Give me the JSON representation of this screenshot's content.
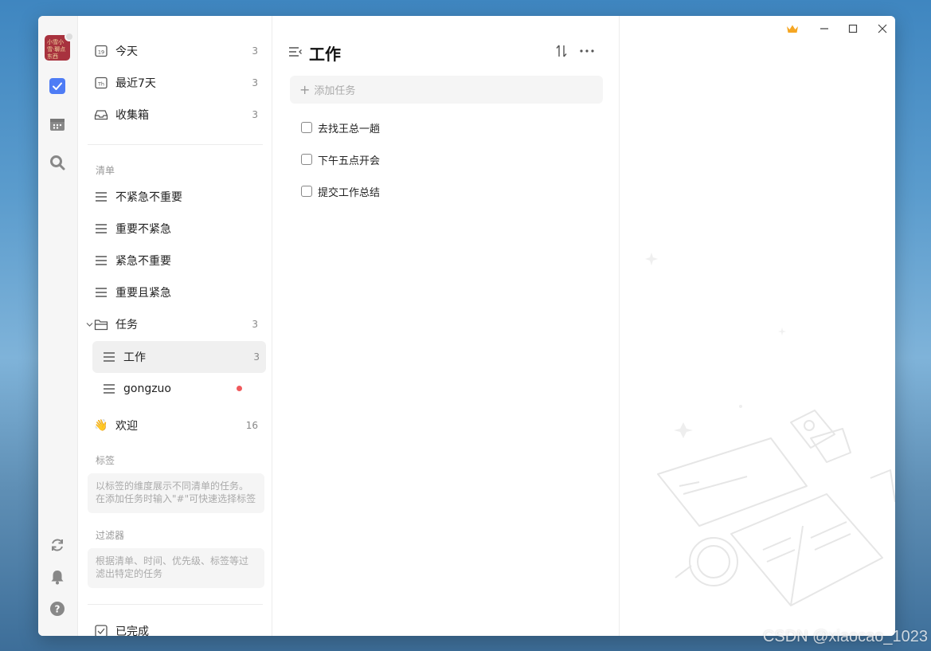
{
  "rail": {
    "avatar_text": "小雪小雪·聊点东西",
    "accent": "#4e7cf5"
  },
  "sidebar": {
    "smart": [
      {
        "label": "今天",
        "count": "3",
        "icon": "calendar-19-icon",
        "icon_text": "19"
      },
      {
        "label": "最近7天",
        "count": "3",
        "icon": "calendar-th-icon",
        "icon_text": "Th"
      },
      {
        "label": "收集箱",
        "count": "3",
        "icon": "inbox-icon"
      }
    ],
    "lists_label": "清单",
    "lists": [
      {
        "label": "不紧急不重要"
      },
      {
        "label": "重要不紧急"
      },
      {
        "label": "紧急不重要"
      },
      {
        "label": "重要且紧急"
      }
    ],
    "folder": {
      "label": "任务",
      "count": "3"
    },
    "folder_children": [
      {
        "label": "工作",
        "count": "3"
      },
      {
        "label": "gongzuo"
      }
    ],
    "welcome": {
      "label": "欢迎",
      "count": "16",
      "emoji": "👋"
    },
    "tags_label": "标签",
    "tags_hint": "以标签的维度展示不同清单的任务。在添加任务时输入\"#\"可快速选择标签",
    "filters_label": "过滤器",
    "filters_hint": "根据清单、时间、优先级、标签等过滤出特定的任务",
    "completed_label": "已完成"
  },
  "main": {
    "title": "工作",
    "add_placeholder": "添加任务",
    "tasks": [
      {
        "title": "去找王总一趟",
        "done": false
      },
      {
        "title": "下午五点开会",
        "done": false
      },
      {
        "title": "提交工作总结",
        "done": false
      }
    ]
  },
  "watermark": "CSDN @xiaocao_1023",
  "colors": {
    "crown": "#f5a623",
    "unread_dot": "#f0595c"
  }
}
